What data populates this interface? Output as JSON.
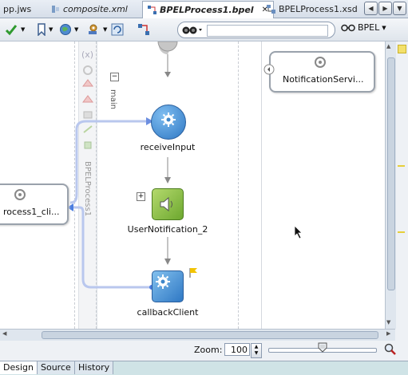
{
  "tabs": [
    {
      "label": "pp.jws",
      "active": false
    },
    {
      "label": "composite.xml",
      "active": false
    },
    {
      "label": "BPELProcess1.bpel",
      "active": true
    },
    {
      "label": "BPELProcess1.xsd",
      "active": false
    }
  ],
  "toolbar": {
    "mode_label": "BPEL",
    "search_value": ""
  },
  "canvas": {
    "scope_label": "main",
    "partner_lane_label": "BPELProcess1",
    "left_partner": "rocess1_cli...",
    "right_partner": "NotificationServi...",
    "activities": [
      {
        "label": "receiveInput"
      },
      {
        "label": "UserNotification_2"
      },
      {
        "label": "callbackClient"
      }
    ],
    "variables_symbol": "(x)"
  },
  "zoom": {
    "label": "Zoom:",
    "value": "100",
    "slider_fraction": 0.5
  },
  "bottom_tabs": [
    {
      "label": "Design",
      "active": true
    },
    {
      "label": "Source",
      "active": false
    },
    {
      "label": "History",
      "active": false
    }
  ],
  "colors": {
    "activity_blue": "#3f87c9",
    "activity_green": "#8dc63f",
    "connector": "#b9c7ee"
  }
}
